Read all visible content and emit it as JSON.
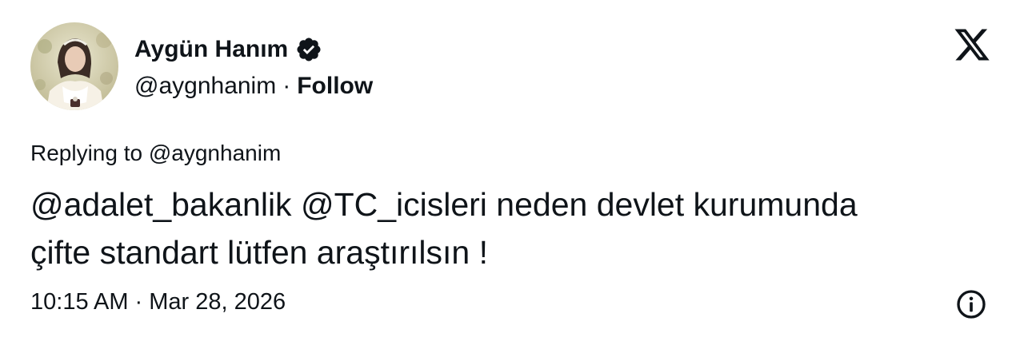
{
  "author": {
    "name": "Aygün Hanım",
    "handle": "@aygnhanim",
    "separator": "·",
    "follow_label": "Follow",
    "avatar_icon": "profile-photo",
    "verified_icon": "verified-badge-icon"
  },
  "header": {
    "logo_icon": "x-logo-icon"
  },
  "tweet": {
    "replying_to": "Replying to @aygnhanim",
    "text_line1": "@adalet_bakanlik @TC_icisleri neden devlet kurumunda",
    "text_line2": "çifte standart lütfen araştırılsın !"
  },
  "footer": {
    "time": "10:15 AM",
    "separator": "·",
    "date": "Mar 28, 2026",
    "info_icon": "info-icon"
  },
  "colors": {
    "text": "#0f1419",
    "background": "#ffffff"
  }
}
